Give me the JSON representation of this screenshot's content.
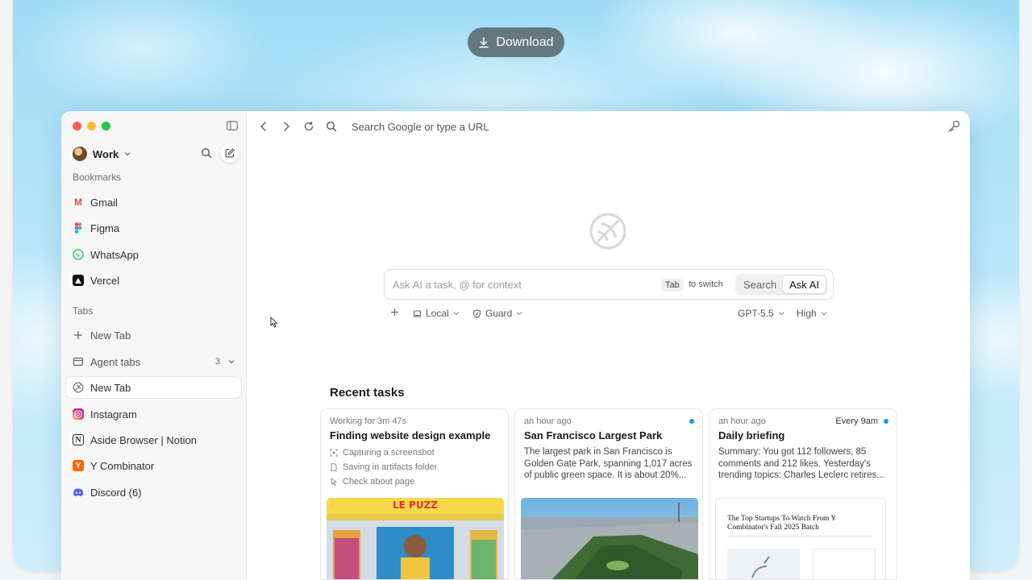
{
  "download_label": "Download",
  "sidebar": {
    "profile": "Work",
    "bookmarks_title": "Bookmarks",
    "bookmarks": [
      {
        "label": "Gmail",
        "icon": "gmail-icon"
      },
      {
        "label": "Figma",
        "icon": "figma-icon"
      },
      {
        "label": "WhatsApp",
        "icon": "whatsapp-icon"
      },
      {
        "label": "Vercel",
        "icon": "vercel-icon"
      }
    ],
    "tabs_title": "Tabs",
    "new_tab_action": "New Tab",
    "agent_tabs": {
      "label": "Agent tabs",
      "count": "3"
    },
    "tabs": [
      {
        "label": "New Tab",
        "icon": "aside-icon",
        "active": true
      },
      {
        "label": "Instagram",
        "icon": "instagram-icon"
      },
      {
        "label": "Aside Browser | Notion",
        "icon": "notion-icon"
      },
      {
        "label": "Y Combinator",
        "icon": "ycombinator-icon"
      },
      {
        "label": "Discord (6)",
        "icon": "discord-icon"
      }
    ]
  },
  "toolbar": {
    "url_placeholder": "Search Google or type a URL"
  },
  "ask": {
    "placeholder": "Ask AI a task, @ for context",
    "tab_key": "Tab",
    "to_switch": "to switch",
    "mode_search": "Search",
    "mode_ask": "Ask AI"
  },
  "options": {
    "location": "Local",
    "guard": "Guard",
    "model": "GPT-5.5",
    "effort": "High"
  },
  "recent": {
    "title": "Recent tasks",
    "cards": [
      {
        "meta": "Working for 3m 47s",
        "title": "Finding website design example",
        "steps": [
          "Capturing a screenshot",
          "Saving in artifacts folder",
          "Check about page"
        ]
      },
      {
        "meta": "an hour ago",
        "title": "San Francisco Largest Park",
        "desc": "The largest park in San Francisco is Golden Gate Park, spanning 1,017 acres of public green space. It is about 20%..."
      },
      {
        "meta": "an hour ago",
        "schedule": "Every 9am",
        "title": "Daily briefing",
        "desc": "Summary: You got 112 followers, 85 comments and 212 likes. Yesterday's trending topics: Charles Leclerc retires...",
        "article_title": "The Top Startups To Watch From Y Combinator's Fall 2025 Batch"
      }
    ]
  },
  "colors": {
    "accent_dot": "#1a9ae6",
    "traffic_red": "#fe5f57",
    "traffic_yellow": "#febc2e",
    "traffic_green": "#28c840"
  }
}
